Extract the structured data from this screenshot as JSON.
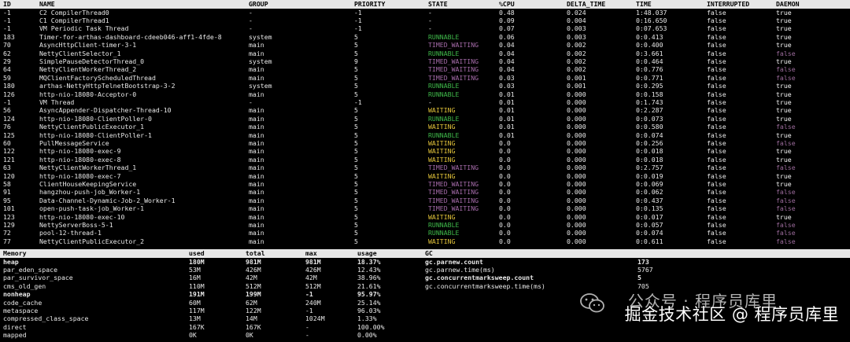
{
  "thread_headers": [
    "ID",
    "NAME",
    "GROUP",
    "PRIORITY",
    "STATE",
    "%CPU",
    "DELTA_TIME",
    "TIME",
    "INTERRUPTED",
    "DAEMON"
  ],
  "threads": [
    {
      "id": "-1",
      "name": "C2 CompilerThread0",
      "group": "-",
      "priority": "-1",
      "state": "-",
      "cpu": "0.48",
      "delta": "0.024",
      "time": "1:48.037",
      "interrupted": "false",
      "daemon": "true"
    },
    {
      "id": "-1",
      "name": "C1 CompilerThread1",
      "group": "-",
      "priority": "-1",
      "state": "-",
      "cpu": "0.09",
      "delta": "0.004",
      "time": "0:16.650",
      "interrupted": "false",
      "daemon": "true"
    },
    {
      "id": "-1",
      "name": "VM Periodic Task Thread",
      "group": "-",
      "priority": "-1",
      "state": "-",
      "cpu": "0.07",
      "delta": "0.003",
      "time": "0:07.653",
      "interrupted": "false",
      "daemon": "true"
    },
    {
      "id": "183",
      "name": "Timer-for-arthas-dashboard-cdeeb046-aff1-4fde-8",
      "group": "system",
      "priority": "5",
      "state": "RUNNABLE",
      "cpu": "0.06",
      "delta": "0.003",
      "time": "0:0.413",
      "interrupted": "false",
      "daemon": "true"
    },
    {
      "id": "70",
      "name": "AsyncHttpClient-timer-3-1",
      "group": "main",
      "priority": "5",
      "state": "TIMED_WAITING",
      "cpu": "0.04",
      "delta": "0.002",
      "time": "0:0.400",
      "interrupted": "false",
      "daemon": "true"
    },
    {
      "id": "62",
      "name": "NettyClientSelector_1",
      "group": "main",
      "priority": "5",
      "state": "RUNNABLE",
      "cpu": "0.04",
      "delta": "0.002",
      "time": "0:3.661",
      "interrupted": "false",
      "daemon": "false"
    },
    {
      "id": "29",
      "name": "SimplePauseDetectorThread_0",
      "group": "system",
      "priority": "9",
      "state": "TIMED_WAITING",
      "cpu": "0.04",
      "delta": "0.002",
      "time": "0:0.464",
      "interrupted": "false",
      "daemon": "true"
    },
    {
      "id": "64",
      "name": "NettyClientWorkerThread_2",
      "group": "main",
      "priority": "5",
      "state": "TIMED_WAITING",
      "cpu": "0.04",
      "delta": "0.002",
      "time": "0:0.776",
      "interrupted": "false",
      "daemon": "false"
    },
    {
      "id": "59",
      "name": "MQClientFactoryScheduledThread",
      "group": "main",
      "priority": "5",
      "state": "TIMED_WAITING",
      "cpu": "0.03",
      "delta": "0.001",
      "time": "0:0.771",
      "interrupted": "false",
      "daemon": "false"
    },
    {
      "id": "180",
      "name": "arthas-NettyHttpTelnetBootstrap-3-2",
      "group": "system",
      "priority": "5",
      "state": "RUNNABLE",
      "cpu": "0.03",
      "delta": "0.001",
      "time": "0:0.295",
      "interrupted": "false",
      "daemon": "true"
    },
    {
      "id": "126",
      "name": "http-nio-18080-Acceptor-0",
      "group": "main",
      "priority": "5",
      "state": "RUNNABLE",
      "cpu": "0.01",
      "delta": "0.000",
      "time": "0:0.158",
      "interrupted": "false",
      "daemon": "true"
    },
    {
      "id": "-1",
      "name": "VM Thread",
      "group": "-",
      "priority": "-1",
      "state": "-",
      "cpu": "0.01",
      "delta": "0.000",
      "time": "0:1.743",
      "interrupted": "false",
      "daemon": "true"
    },
    {
      "id": "56",
      "name": "AsyncAppender-Dispatcher-Thread-10",
      "group": "main",
      "priority": "5",
      "state": "WAITING",
      "cpu": "0.01",
      "delta": "0.000",
      "time": "0:2.287",
      "interrupted": "false",
      "daemon": "true"
    },
    {
      "id": "124",
      "name": "http-nio-18080-ClientPoller-0",
      "group": "main",
      "priority": "5",
      "state": "RUNNABLE",
      "cpu": "0.01",
      "delta": "0.000",
      "time": "0:0.073",
      "interrupted": "false",
      "daemon": "true"
    },
    {
      "id": "76",
      "name": "NettyClientPublicExecutor_1",
      "group": "main",
      "priority": "5",
      "state": "WAITING",
      "cpu": "0.01",
      "delta": "0.000",
      "time": "0:0.580",
      "interrupted": "false",
      "daemon": "false"
    },
    {
      "id": "125",
      "name": "http-nio-18080-ClientPoller-1",
      "group": "main",
      "priority": "5",
      "state": "RUNNABLE",
      "cpu": "0.01",
      "delta": "0.000",
      "time": "0:0.074",
      "interrupted": "false",
      "daemon": "true"
    },
    {
      "id": "60",
      "name": "PullMessageService",
      "group": "main",
      "priority": "5",
      "state": "WAITING",
      "cpu": "0.0",
      "delta": "0.000",
      "time": "0:0.256",
      "interrupted": "false",
      "daemon": "false"
    },
    {
      "id": "122",
      "name": "http-nio-18080-exec-9",
      "group": "main",
      "priority": "5",
      "state": "WAITING",
      "cpu": "0.0",
      "delta": "0.000",
      "time": "0:0.018",
      "interrupted": "false",
      "daemon": "true"
    },
    {
      "id": "121",
      "name": "http-nio-18080-exec-8",
      "group": "main",
      "priority": "5",
      "state": "WAITING",
      "cpu": "0.0",
      "delta": "0.000",
      "time": "0:0.018",
      "interrupted": "false",
      "daemon": "true"
    },
    {
      "id": "63",
      "name": "NettyClientWorkerThread_1",
      "group": "main",
      "priority": "5",
      "state": "TIMED_WAITING",
      "cpu": "0.0",
      "delta": "0.000",
      "time": "0:2.757",
      "interrupted": "false",
      "daemon": "false"
    },
    {
      "id": "120",
      "name": "http-nio-18080-exec-7",
      "group": "main",
      "priority": "5",
      "state": "WAITING",
      "cpu": "0.0",
      "delta": "0.000",
      "time": "0:0.019",
      "interrupted": "false",
      "daemon": "true"
    },
    {
      "id": "58",
      "name": "ClientHouseKeepingService",
      "group": "main",
      "priority": "5",
      "state": "TIMED_WAITING",
      "cpu": "0.0",
      "delta": "0.000",
      "time": "0:0.069",
      "interrupted": "false",
      "daemon": "true"
    },
    {
      "id": "91",
      "name": "hangzhou-push-job_Worker-1",
      "group": "main",
      "priority": "5",
      "state": "TIMED_WAITING",
      "cpu": "0.0",
      "delta": "0.000",
      "time": "0:0.062",
      "interrupted": "false",
      "daemon": "false"
    },
    {
      "id": "95",
      "name": "Data-Channel-Dynamic-Job-2_Worker-1",
      "group": "main",
      "priority": "5",
      "state": "TIMED_WAITING",
      "cpu": "0.0",
      "delta": "0.000",
      "time": "0:0.437",
      "interrupted": "false",
      "daemon": "false"
    },
    {
      "id": "101",
      "name": "open-push-task-job_Worker-1",
      "group": "main",
      "priority": "5",
      "state": "TIMED_WAITING",
      "cpu": "0.0",
      "delta": "0.000",
      "time": "0:0.135",
      "interrupted": "false",
      "daemon": "false"
    },
    {
      "id": "123",
      "name": "http-nio-18080-exec-10",
      "group": "main",
      "priority": "5",
      "state": "WAITING",
      "cpu": "0.0",
      "delta": "0.000",
      "time": "0:0.017",
      "interrupted": "false",
      "daemon": "true"
    },
    {
      "id": "129",
      "name": "NettyServerBoss-5-1",
      "group": "main",
      "priority": "5",
      "state": "RUNNABLE",
      "cpu": "0.0",
      "delta": "0.000",
      "time": "0:0.057",
      "interrupted": "false",
      "daemon": "false"
    },
    {
      "id": "72",
      "name": "pool-12-thread-1",
      "group": "main",
      "priority": "5",
      "state": "RUNNABLE",
      "cpu": "0.0",
      "delta": "0.000",
      "time": "0:0.074",
      "interrupted": "false",
      "daemon": "false"
    },
    {
      "id": "77",
      "name": "NettyClientPublicExecutor_2",
      "group": "main",
      "priority": "5",
      "state": "WAITING",
      "cpu": "0.0",
      "delta": "0.000",
      "time": "0:0.611",
      "interrupted": "false",
      "daemon": "false"
    }
  ],
  "memory_headers": [
    "Memory",
    "used",
    "total",
    "max",
    "usage",
    "GC"
  ],
  "memory": [
    {
      "name": "heap",
      "used": "180M",
      "total": "981M",
      "max": "981M",
      "usage": "18.37%",
      "bold": true
    },
    {
      "name": "par_eden_space",
      "used": "53M",
      "total": "426M",
      "max": "426M",
      "usage": "12.43%",
      "bold": false
    },
    {
      "name": "par_survivor_space",
      "used": "16M",
      "total": "42M",
      "max": "42M",
      "usage": "38.96%",
      "bold": false
    },
    {
      "name": "cms_old_gen",
      "used": "110M",
      "total": "512M",
      "max": "512M",
      "usage": "21.61%",
      "bold": false
    },
    {
      "name": "nonheap",
      "used": "191M",
      "total": "199M",
      "max": "-1",
      "usage": "95.97%",
      "bold": true
    },
    {
      "name": "code_cache",
      "used": "60M",
      "total": "62M",
      "max": "240M",
      "usage": "25.14%",
      "bold": false
    },
    {
      "name": "metaspace",
      "used": "117M",
      "total": "122M",
      "max": "-1",
      "usage": "96.03%",
      "bold": false
    },
    {
      "name": "compressed_class_space",
      "used": "13M",
      "total": "14M",
      "max": "1024M",
      "usage": "1.33%",
      "bold": false
    },
    {
      "name": "direct",
      "used": "167K",
      "total": "167K",
      "max": "-",
      "usage": "100.00%",
      "bold": false
    },
    {
      "name": "mapped",
      "used": "0K",
      "total": "0K",
      "max": "-",
      "usage": "0.00%",
      "bold": false
    }
  ],
  "gc": [
    {
      "name": "gc.parnew.count",
      "value": "173",
      "bold": true
    },
    {
      "name": "gc.parnew.time(ms)",
      "value": "5767",
      "bold": false
    },
    {
      "name": "gc.concurrentmarksweep.count",
      "value": "5",
      "bold": true
    },
    {
      "name": "gc.concurrentmarksweep.time(ms)",
      "value": "705",
      "bold": false
    }
  ],
  "watermark": {
    "line1": "公众号 · 程序员库里",
    "line2": "掘金技术社区 @ 程序员库里",
    "icon": "wechat-icon"
  },
  "colors": {
    "runnable": "#3fb94a",
    "timed_waiting": "#a56ba9",
    "waiting": "#e2c33a",
    "header_bg": "#e7e7e7",
    "background": "#000000"
  }
}
